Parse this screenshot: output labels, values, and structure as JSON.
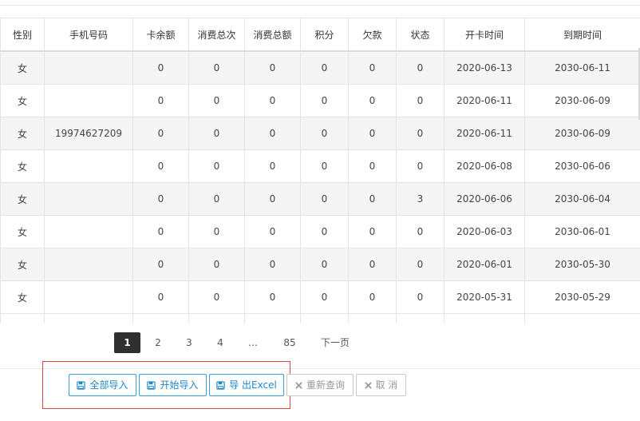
{
  "table": {
    "headers": [
      "性别",
      "手机号码",
      "卡余额",
      "消费总次",
      "消费总额",
      "积分",
      "欠款",
      "状态",
      "开卡时间",
      "到期时间"
    ],
    "rows": [
      [
        "女",
        "",
        "0",
        "0",
        "0",
        "0",
        "0",
        "0",
        "2020-06-13",
        "2030-06-11"
      ],
      [
        "女",
        "",
        "0",
        "0",
        "0",
        "0",
        "0",
        "0",
        "2020-06-11",
        "2030-06-09"
      ],
      [
        "女",
        "19974627209",
        "0",
        "0",
        "0",
        "0",
        "0",
        "0",
        "2020-06-11",
        "2030-06-09"
      ],
      [
        "女",
        "",
        "0",
        "0",
        "0",
        "0",
        "0",
        "0",
        "2020-06-08",
        "2030-06-06"
      ],
      [
        "女",
        "",
        "0",
        "0",
        "0",
        "0",
        "0",
        "3",
        "2020-06-06",
        "2030-06-04"
      ],
      [
        "女",
        "",
        "0",
        "0",
        "0",
        "0",
        "0",
        "0",
        "2020-06-03",
        "2030-06-01"
      ],
      [
        "女",
        "",
        "0",
        "0",
        "0",
        "0",
        "0",
        "0",
        "2020-06-01",
        "2030-05-30"
      ],
      [
        "女",
        "",
        "0",
        "0",
        "0",
        "0",
        "0",
        "0",
        "2020-05-31",
        "2030-05-29"
      ]
    ]
  },
  "pagination": {
    "pages": [
      "1",
      "2",
      "3",
      "4",
      "…",
      "85"
    ],
    "active": "1",
    "next_label": "下一页"
  },
  "actions": {
    "import_all": "全部导入",
    "start_import": "开始导入",
    "export_excel": "导 出Excel",
    "requery": "重新查询",
    "cancel": "取 消"
  },
  "icons": {
    "import_all": "floppy-disk-icon",
    "start_import": "floppy-disk-icon",
    "export_excel": "floppy-disk-icon",
    "requery": "close-icon",
    "cancel": "close-icon"
  },
  "colors": {
    "primary": "#1e88c8",
    "highlight": "#e04646",
    "active_page": "#2f2f2f"
  }
}
